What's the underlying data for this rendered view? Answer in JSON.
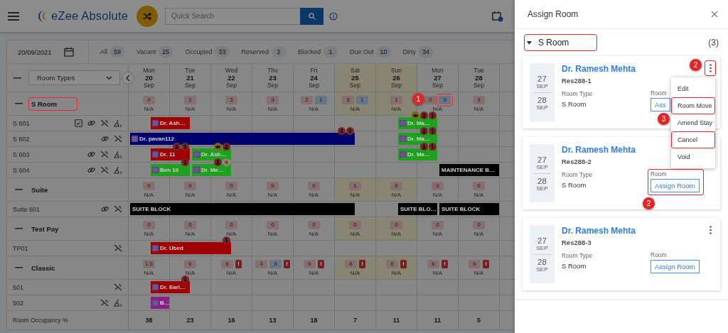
{
  "header": {
    "logo": "eZee Absolute",
    "search": {
      "placeholder": "Quick Search"
    }
  },
  "toolbar": {
    "date": "20/09/2021",
    "filters": [
      {
        "label": "All",
        "count": "59"
      },
      {
        "label": "Vacant",
        "count": "25"
      },
      {
        "label": "Occupied",
        "count": "33"
      },
      {
        "label": "Reserved",
        "count": "2"
      },
      {
        "label": "Blocked",
        "count": "1"
      },
      {
        "label": "Due Out",
        "count": "10"
      },
      {
        "label": "Dirty",
        "count": "34"
      }
    ]
  },
  "grid": {
    "room_types": "Room Types",
    "days": [
      {
        "dow": "Mon",
        "day": "20",
        "month": "Sep",
        "weekend": false
      },
      {
        "dow": "Tue",
        "day": "21",
        "month": "Sep",
        "weekend": false
      },
      {
        "dow": "Wed",
        "day": "22",
        "month": "Sep",
        "weekend": false
      },
      {
        "dow": "Thu",
        "day": "23",
        "month": "Sep",
        "weekend": false
      },
      {
        "dow": "Fri",
        "day": "24",
        "month": "Sep",
        "weekend": false
      },
      {
        "dow": "Sat",
        "day": "25",
        "month": "Sep",
        "weekend": true
      },
      {
        "dow": "Sun",
        "day": "26",
        "month": "Sep",
        "weekend": true
      },
      {
        "dow": "Mon",
        "day": "27",
        "month": "Sep",
        "weekend": false
      },
      {
        "dow": "Tue",
        "day": "28",
        "month": "Sep",
        "weekend": false
      }
    ],
    "groups": [
      {
        "name": "S Room",
        "highlighted": true,
        "availability": [
          {
            "chips": [
              {
                "kind": "count",
                "text": "0",
                "highlighted": false
              }
            ],
            "rate": "N/A"
          },
          {
            "chips": [
              {
                "kind": "count",
                "text": "1",
                "highlighted": false
              }
            ],
            "rate": "N/A"
          },
          {
            "chips": [
              {
                "kind": "count",
                "text": "3",
                "highlighted": false
              }
            ],
            "rate": "N/A"
          },
          {
            "chips": [
              {
                "kind": "count",
                "text": "3",
                "highlighted": false
              }
            ],
            "rate": "N/A"
          },
          {
            "chips": [
              {
                "kind": "count",
                "text": "2",
                "highlighted": false
              },
              {
                "kind": "booked",
                "text": "1",
                "highlighted": false
              }
            ],
            "rate": "N/A"
          },
          {
            "chips": [
              {
                "kind": "count",
                "text": "3",
                "highlighted": false
              },
              {
                "kind": "booked",
                "text": "1",
                "highlighted": false
              }
            ],
            "rate": "N/A"
          },
          {
            "chips": [
              {
                "kind": "count",
                "text": "1",
                "highlighted": false
              }
            ],
            "rate": "N/A"
          },
          {
            "chips": [
              {
                "kind": "count",
                "text": "0",
                "highlighted": false
              },
              {
                "kind": "booked",
                "text": "3",
                "highlighted": true
              }
            ],
            "rate": "N/A",
            "callout": "1"
          },
          {
            "chips": [
              {
                "kind": "count",
                "text": "3",
                "highlighted": false
              }
            ],
            "rate": "N/A"
          }
        ],
        "rooms": [
          {
            "name": "S 601",
            "icons": [
              {
                "kind": "task"
              },
              {
                "kind": "link"
              },
              {
                "kind": "no-clean"
              },
              {
                "kind": "clean"
              }
            ],
            "track": [
              {
                "kind": "empty"
              },
              {
                "kind": "reservation",
                "guest": "Dr. Ash…",
                "color": "#a00000"
              },
              {
                "kind": "continued"
              },
              {
                "kind": "empty"
              },
              {
                "kind": "empty"
              },
              {
                "kind": "empty"
              },
              {
                "kind": "empty"
              },
              {
                "kind": "empty"
              },
              {
                "kind": "empty"
              },
              {
                "kind": "empty"
              },
              {
                "kind": "empty"
              },
              {
                "kind": "empty"
              },
              {
                "kind": "empty"
              },
              {
                "kind": "reservation",
                "guest": "Dr. Ma…",
                "color": "#1fa01f",
                "badges": [
                  {
                    "kind": "crown"
                  },
                  {
                    "kind": "person"
                  },
                  {
                    "kind": "dollar"
                  }
                ]
              },
              {
                "kind": "continued"
              },
              {
                "kind": "empty"
              },
              {
                "kind": "empty"
              },
              {
                "kind": "empty"
              }
            ]
          },
          {
            "name": "S 602",
            "icons": [
              {
                "kind": "link"
              },
              {
                "kind": "no-clean"
              }
            ],
            "track": [
              {
                "kind": "reservation",
                "guest": "Dr. pavan112",
                "color": "#00006e",
                "badges": [
                  {
                    "kind": "person"
                  },
                  {
                    "kind": "dollar"
                  }
                ]
              },
              {
                "kind": "continued"
              },
              {
                "kind": "continued"
              },
              {
                "kind": "continued"
              },
              {
                "kind": "continued"
              },
              {
                "kind": "continued"
              },
              {
                "kind": "continued"
              },
              {
                "kind": "continued"
              },
              {
                "kind": "continued"
              },
              {
                "kind": "continued"
              },
              {
                "kind": "continued"
              },
              {
                "kind": "empty"
              },
              {
                "kind": "empty"
              },
              {
                "kind": "reservation",
                "guest": "Dr. Ma…",
                "color": "#1fa01f",
                "badges": [
                  {
                    "kind": "person"
                  },
                  {
                    "kind": "dollar"
                  }
                ]
              },
              {
                "kind": "continued"
              },
              {
                "kind": "empty"
              },
              {
                "kind": "empty"
              },
              {
                "kind": "empty"
              }
            ]
          },
          {
            "name": "S 603",
            "icons": [
              {
                "kind": "link"
              },
              {
                "kind": "no-clean"
              },
              {
                "kind": "clean"
              }
            ],
            "track": [
              {
                "kind": "empty"
              },
              {
                "kind": "reservation",
                "guest": "Dr. 11",
                "color": "#a00000",
                "badges": [
                  {
                    "kind": "person"
                  },
                  {
                    "kind": "dollar"
                  }
                ]
              },
              {
                "kind": "continued"
              },
              {
                "kind": "reservation",
                "guest": "Dr. Ash…",
                "color": "#1fa01f",
                "badges": [
                  {
                    "kind": "crown"
                  },
                  {
                    "kind": "person"
                  }
                ]
              },
              {
                "kind": "continued"
              },
              {
                "kind": "empty"
              },
              {
                "kind": "empty"
              },
              {
                "kind": "empty"
              },
              {
                "kind": "empty"
              },
              {
                "kind": "empty"
              },
              {
                "kind": "empty"
              },
              {
                "kind": "empty"
              },
              {
                "kind": "empty"
              },
              {
                "kind": "reservation",
                "guest": "Dr. Ma…",
                "color": "#1fa01f",
                "badges": [
                  {
                    "kind": "person"
                  },
                  {
                    "kind": "dollar"
                  }
                ]
              },
              {
                "kind": "continued"
              },
              {
                "kind": "empty"
              },
              {
                "kind": "empty"
              },
              {
                "kind": "empty"
              }
            ]
          },
          {
            "name": "S 604",
            "icons": [
              {
                "kind": "link"
              },
              {
                "kind": "no-clean"
              },
              {
                "kind": "clean"
              }
            ],
            "track": [
              {
                "kind": "empty"
              },
              {
                "kind": "reservation",
                "guest": "Ben 10",
                "color": "#1fa01f",
                "badges": [
                  {
                    "kind": "dollar"
                  }
                ]
              },
              {
                "kind": "continued"
              },
              {
                "kind": "reservation",
                "guest": "Dr. Me…",
                "color": "#1fa01f",
                "badges": [
                  {
                    "kind": "person"
                  },
                  {
                    "kind": "star"
                  }
                ]
              },
              {
                "kind": "continued"
              },
              {
                "kind": "empty"
              },
              {
                "kind": "empty"
              },
              {
                "kind": "empty"
              },
              {
                "kind": "empty"
              },
              {
                "kind": "empty"
              },
              {
                "kind": "empty"
              },
              {
                "kind": "empty"
              },
              {
                "kind": "empty"
              },
              {
                "kind": "empty"
              },
              {
                "kind": "empty"
              },
              {
                "kind": "block",
                "guest": "MAINTENANCE B…",
                "color": "#000000"
              },
              {
                "kind": "continued"
              },
              {
                "kind": "continued"
              }
            ]
          }
        ]
      },
      {
        "name": "Suite",
        "highlighted": false,
        "availability": [
          {
            "chips": [
              {
                "kind": "count",
                "text": "0",
                "highlighted": false
              }
            ],
            "rate": "N/A"
          },
          {
            "chips": [
              {
                "kind": "count",
                "text": "0",
                "highlighted": false
              }
            ],
            "rate": "N/A"
          },
          {
            "chips": [
              {
                "kind": "count",
                "text": "0",
                "highlighted": false
              }
            ],
            "rate": "N/A"
          },
          {
            "chips": [
              {
                "kind": "count",
                "text": "0",
                "highlighted": false
              }
            ],
            "rate": "N/A"
          },
          {
            "chips": [
              {
                "kind": "count",
                "text": "0",
                "highlighted": false
              }
            ],
            "rate": "N/A"
          },
          {
            "chips": [
              {
                "kind": "count",
                "text": "1",
                "highlighted": false
              }
            ],
            "rate": "N/A"
          },
          {
            "chips": [
              {
                "kind": "count",
                "text": "0",
                "highlighted": false
              }
            ],
            "rate": "N/A"
          },
          {
            "chips": [
              {
                "kind": "count",
                "text": "0",
                "highlighted": false
              }
            ],
            "rate": "N/A"
          },
          {
            "chips": [
              {
                "kind": "count",
                "text": "0",
                "highlighted": false
              }
            ],
            "rate": "N/A"
          }
        ],
        "rooms": [
          {
            "name": "Suite 601",
            "icons": [
              {
                "kind": "link"
              },
              {
                "kind": "no-clean"
              }
            ],
            "track": [
              {
                "kind": "block",
                "guest": "SUITE BLOCK",
                "color": "#000000"
              },
              {
                "kind": "continued"
              },
              {
                "kind": "continued"
              },
              {
                "kind": "continued"
              },
              {
                "kind": "continued"
              },
              {
                "kind": "continued"
              },
              {
                "kind": "continued"
              },
              {
                "kind": "continued"
              },
              {
                "kind": "continued"
              },
              {
                "kind": "continued"
              },
              {
                "kind": "continued"
              },
              {
                "kind": "empty"
              },
              {
                "kind": "empty"
              },
              {
                "kind": "block",
                "guest": "SUITE BLO…",
                "color": "#000000"
              },
              {
                "kind": "continued"
              },
              {
                "kind": "block",
                "guest": "SUITE BLOCK",
                "color": "#000000"
              },
              {
                "kind": "continued"
              },
              {
                "kind": "continued"
              }
            ]
          }
        ]
      },
      {
        "name": "Test Pay",
        "highlighted": false,
        "availability": [
          {
            "chips": [
              {
                "kind": "count",
                "text": "0",
                "highlighted": false
              }
            ],
            "rate": "N/A"
          },
          {
            "chips": [
              {
                "kind": "count",
                "text": "0",
                "highlighted": false
              }
            ],
            "rate": "N/A"
          },
          {
            "chips": [
              {
                "kind": "count",
                "text": "0",
                "highlighted": false
              }
            ],
            "rate": "N/A"
          },
          {
            "chips": [
              {
                "kind": "count",
                "text": "0",
                "highlighted": false
              }
            ],
            "rate": "N/A"
          },
          {
            "chips": [
              {
                "kind": "count",
                "text": "0",
                "highlighted": false
              }
            ],
            "rate": "N/A"
          },
          {
            "chips": [
              {
                "kind": "count",
                "text": "0",
                "highlighted": false
              }
            ],
            "rate": "N/A"
          },
          {
            "chips": [
              {
                "kind": "count",
                "text": "0",
                "highlighted": false
              }
            ],
            "rate": "N/A"
          },
          {
            "chips": [
              {
                "kind": "count",
                "text": "0",
                "highlighted": false
              }
            ],
            "rate": "N/A"
          },
          {
            "chips": [
              {
                "kind": "count",
                "text": "0",
                "highlighted": false
              }
            ],
            "rate": "N/A"
          }
        ],
        "rooms": [
          {
            "name": "TP01",
            "icons": [
              {
                "kind": "no-clean"
              }
            ],
            "track": [
              {
                "kind": "empty"
              },
              {
                "kind": "reservation",
                "guest": "Dr. Ubed",
                "color": "#a00000",
                "badges": [
                  {
                    "kind": "dollar"
                  }
                ]
              },
              {
                "kind": "continued"
              },
              {
                "kind": "continued"
              },
              {
                "kind": "continued"
              },
              {
                "kind": "empty"
              },
              {
                "kind": "empty"
              },
              {
                "kind": "empty"
              },
              {
                "kind": "empty"
              },
              {
                "kind": "empty"
              },
              {
                "kind": "empty"
              },
              {
                "kind": "empty"
              },
              {
                "kind": "empty"
              },
              {
                "kind": "empty"
              },
              {
                "kind": "empty"
              },
              {
                "kind": "empty"
              },
              {
                "kind": "empty"
              },
              {
                "kind": "empty"
              }
            ]
          }
        ]
      },
      {
        "name": "Classic",
        "highlighted": false,
        "availability": [
          {
            "chips": [
              {
                "kind": "count",
                "text": "1.5",
                "highlighted": false
              }
            ],
            "rate": "N/A"
          },
          {
            "chips": [
              {
                "kind": "count",
                "text": "6",
                "highlighted": false
              }
            ],
            "rate": "N/A"
          },
          {
            "chips": [
              {
                "kind": "count",
                "text": "6",
                "highlighted": false
              },
              {
                "kind": "alert",
                "text": "!",
                "highlighted": false
              }
            ],
            "rate": "N/A"
          },
          {
            "chips": [
              {
                "kind": "count",
                "text": "3",
                "highlighted": false
              },
              {
                "kind": "booked",
                "text": "3",
                "highlighted": false
              },
              {
                "kind": "alert",
                "text": "!",
                "highlighted": false
              }
            ],
            "rate": "N/A"
          },
          {
            "chips": [
              {
                "kind": "count",
                "text": "6",
                "highlighted": false
              },
              {
                "kind": "alert",
                "text": "!",
                "highlighted": false
              }
            ],
            "rate": "N/A"
          },
          {
            "chips": [
              {
                "kind": "count",
                "text": "6",
                "highlighted": false
              },
              {
                "kind": "alert",
                "text": "!",
                "highlighted": false
              }
            ],
            "rate": "N/A"
          },
          {
            "chips": [
              {
                "kind": "count",
                "text": "6",
                "highlighted": false
              },
              {
                "kind": "alert",
                "text": "!",
                "highlighted": false
              }
            ],
            "rate": "N/A"
          },
          {
            "chips": [
              {
                "kind": "count",
                "text": "6",
                "highlighted": false
              },
              {
                "kind": "alert",
                "text": "!",
                "highlighted": false
              }
            ],
            "rate": "N/A"
          },
          {
            "chips": [
              {
                "kind": "count",
                "text": "6",
                "highlighted": false
              },
              {
                "kind": "alert",
                "text": "!",
                "highlighted": false
              }
            ],
            "rate": "N/A"
          }
        ],
        "rooms": [
          {
            "name": "501",
            "icons": [
              {
                "kind": "no-clean"
              }
            ],
            "track": [
              {
                "kind": "empty"
              },
              {
                "kind": "reservation",
                "guest": "Dr. Earl…",
                "color": "#a00000",
                "badges": [
                  {
                    "kind": "dollar"
                  }
                ]
              },
              {
                "kind": "continued"
              },
              {
                "kind": "empty"
              },
              {
                "kind": "empty"
              },
              {
                "kind": "empty"
              },
              {
                "kind": "empty"
              },
              {
                "kind": "empty"
              },
              {
                "kind": "empty"
              },
              {
                "kind": "empty"
              },
              {
                "kind": "empty"
              },
              {
                "kind": "empty"
              },
              {
                "kind": "empty"
              },
              {
                "kind": "empty"
              },
              {
                "kind": "empty"
              },
              {
                "kind": "empty"
              },
              {
                "kind": "empty"
              },
              {
                "kind": "empty"
              }
            ]
          },
          {
            "name": "502",
            "icons": [
              {
                "kind": "no-clean"
              },
              {
                "kind": "clean"
              }
            ],
            "track": [
              {
                "kind": "empty"
              },
              {
                "kind": "reservation",
                "guest": "B…",
                "color": "#8c1f8c"
              },
              {
                "kind": "empty"
              },
              {
                "kind": "empty"
              },
              {
                "kind": "empty"
              },
              {
                "kind": "empty"
              },
              {
                "kind": "empty"
              },
              {
                "kind": "empty"
              },
              {
                "kind": "empty"
              },
              {
                "kind": "empty"
              },
              {
                "kind": "empty"
              },
              {
                "kind": "empty"
              },
              {
                "kind": "empty"
              },
              {
                "kind": "empty"
              },
              {
                "kind": "empty"
              },
              {
                "kind": "empty"
              },
              {
                "kind": "empty"
              },
              {
                "kind": "empty"
              }
            ]
          }
        ]
      }
    ],
    "occupancy": {
      "label": "Room Occupancy %",
      "values": [
        "38",
        "23",
        "16",
        "13",
        "18",
        "7",
        "11",
        "11",
        "5"
      ]
    }
  },
  "panel": {
    "title": "Assign Room",
    "group": {
      "name": "S Room",
      "count": "(3)",
      "highlighted": true
    },
    "cards": [
      {
        "arrival_day": "27",
        "arrival_month": "SEP",
        "departure_day": "28",
        "departure_month": "SEP",
        "guest": "Dr. Ramesh Mehta",
        "reservation": "Res288-1",
        "room_type_label": "Room Type",
        "room_type": "S Room",
        "room_label": "Room",
        "action": "Ass",
        "room_highlighted": false,
        "menu_button": {
          "highlighted": true,
          "callout": "2"
        },
        "menu": [
          {
            "label": "Edit",
            "highlighted": false
          },
          {
            "label": "Room Move",
            "highlighted": true
          },
          {
            "label": "Amend Stay",
            "highlighted": false
          },
          {
            "label": "Cancel",
            "highlighted": true
          },
          {
            "label": "Void",
            "highlighted": false
          }
        ],
        "menu_callout": "3"
      },
      {
        "arrival_day": "27",
        "arrival_month": "SEP",
        "departure_day": "28",
        "departure_month": "SEP",
        "guest": "Dr. Ramesh Mehta",
        "reservation": "Res288-2",
        "room_type_label": "Room Type",
        "room_type": "S Room",
        "room_label": "Room",
        "action": "Assign Room",
        "room_highlighted": true,
        "room_callout": "2"
      },
      {
        "arrival_day": "27",
        "arrival_month": "SEP",
        "departure_day": "28",
        "departure_month": "SEP",
        "guest": "Dr. Ramesh Mehta",
        "reservation": "Res288-3",
        "room_type_label": "Room Type",
        "room_type": "S Room",
        "room_label": "Room",
        "action": "Assign Room",
        "room_highlighted": false,
        "menu_button": {
          "highlighted": false
        }
      }
    ]
  }
}
